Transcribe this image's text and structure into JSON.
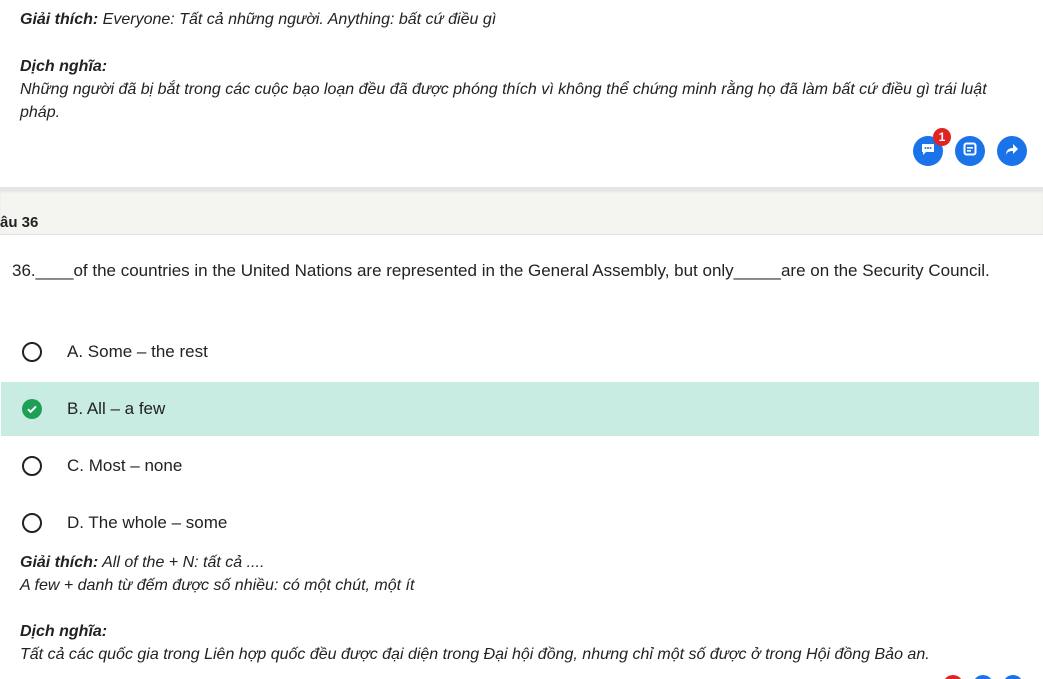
{
  "prev_explanation": {
    "label": "Giải thích:",
    "text": " Everyone: Tất cả những người. Anything: bất cứ điều gì"
  },
  "prev_translation": {
    "label": "Dịch nghĩa:",
    "text": "Những người đã bị bắt trong các cuộc bạo loạn đều đã được phóng thích vì không thể chứng minh rằng họ đã làm bất cứ điều gì trái luật pháp."
  },
  "actions": {
    "comment_badge": "1",
    "comment_icon": "comment-icon",
    "note_icon": "note-icon",
    "share_icon": "share-icon",
    "color": "#1a73e8"
  },
  "question": {
    "header": "âu 36",
    "text": "36.____of the countries in the United Nations are represented in the General Assembly, but only_____are on the Security Council.",
    "options": [
      {
        "label": "A. Some – the rest",
        "correct": false
      },
      {
        "label": "B. All – a few",
        "correct": true
      },
      {
        "label": "C. Most – none",
        "correct": false
      },
      {
        "label": "D. The whole – some",
        "correct": false
      }
    ]
  },
  "explanation": {
    "label": "Giải thích:",
    "line1": " All of the + N: tất cả ....",
    "line2": "A few + danh từ đếm được số nhiều: có một chút, một ít"
  },
  "translation": {
    "label": "Dịch nghĩa:",
    "text": "Tất cả các quốc gia trong Liên hợp quốc đều được đại diện trong Đại hội đồng, nhưng chỉ một số được ở trong Hội đồng Bảo an."
  }
}
